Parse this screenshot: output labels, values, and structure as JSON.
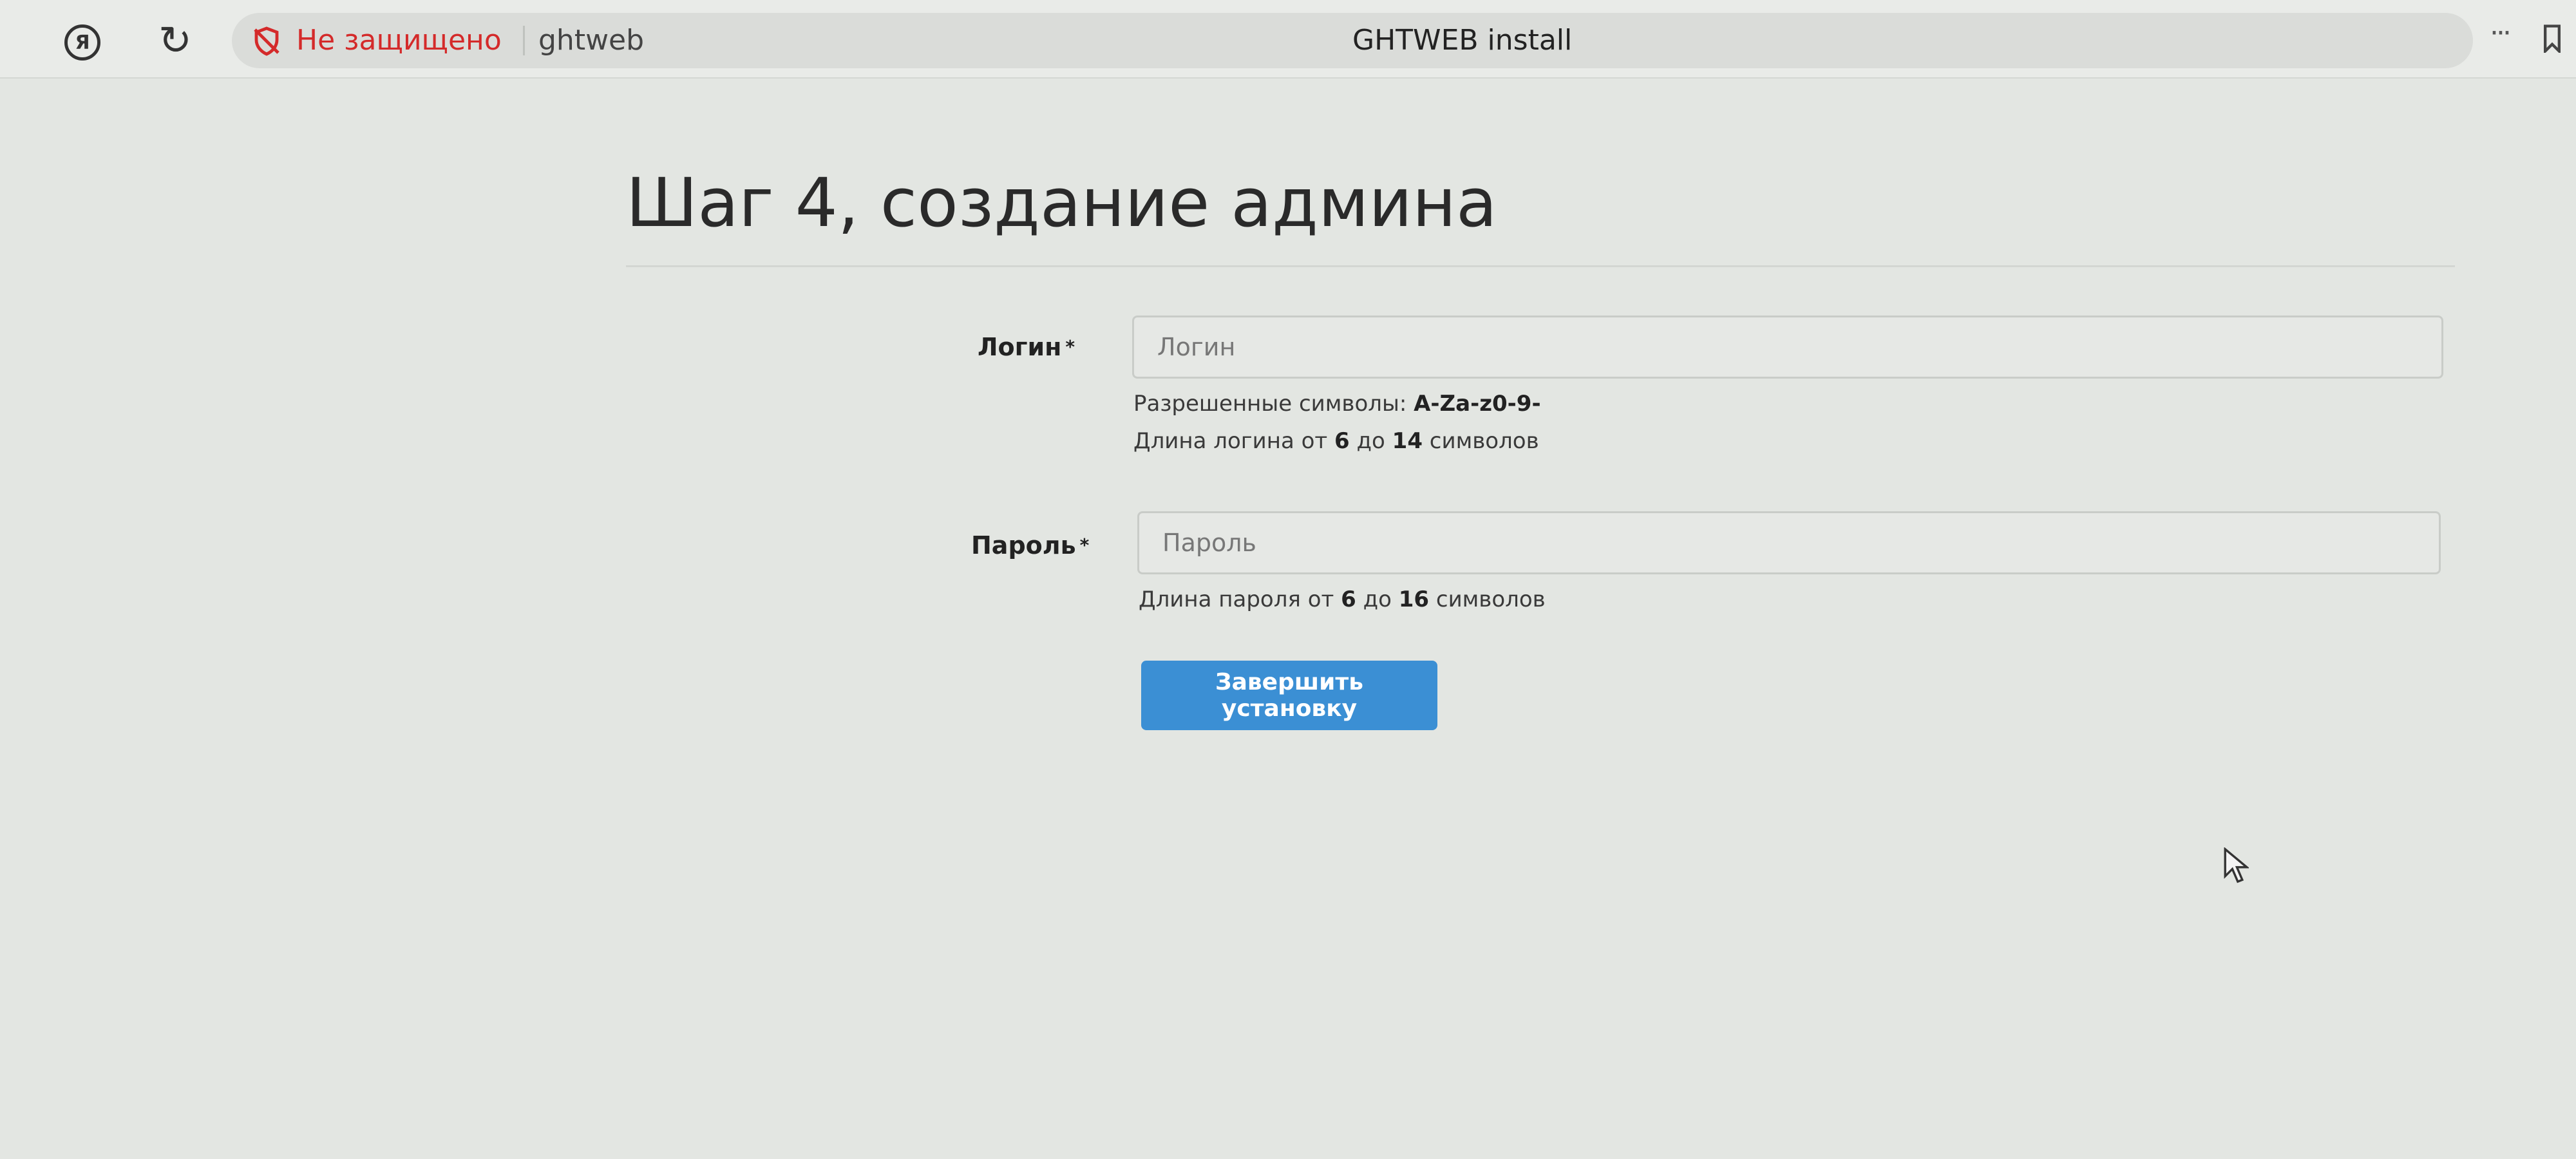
{
  "browser": {
    "yandex_glyph": "Я",
    "reload_glyph": "↻",
    "security_status": "Не защищено",
    "domain": "ghtweb",
    "tab_title": "GHTWEB install",
    "more_glyph": "···",
    "icons": {
      "yandex": "yandex-logo-icon",
      "reload": "reload-icon",
      "security": "shield-off-icon",
      "more": "more-horizontal-icon",
      "bookmark": "bookmark-icon"
    },
    "security_color": "#d42a2a"
  },
  "page": {
    "title": "Шаг 4, создание админа",
    "login": {
      "label": "Логин",
      "required_mark": "*",
      "placeholder": "Логин",
      "value": "",
      "help_line1_prefix": "Разрешенные символы: ",
      "help_line1_value": "A-Za-z0-9-",
      "help_line2_prefix": "Длина логина от ",
      "help_line2_min": "6",
      "help_line2_mid": " до ",
      "help_line2_max": "14",
      "help_line2_suffix": " символов"
    },
    "password": {
      "label": "Пароль",
      "required_mark": "*",
      "placeholder": "Пароль",
      "value": "",
      "help_prefix": "Длина пароля от ",
      "help_min": "6",
      "help_mid": " до ",
      "help_max": "16",
      "help_suffix": " символов"
    },
    "submit_label": "Завершить установку",
    "accent_color": "#3b8fd4"
  }
}
